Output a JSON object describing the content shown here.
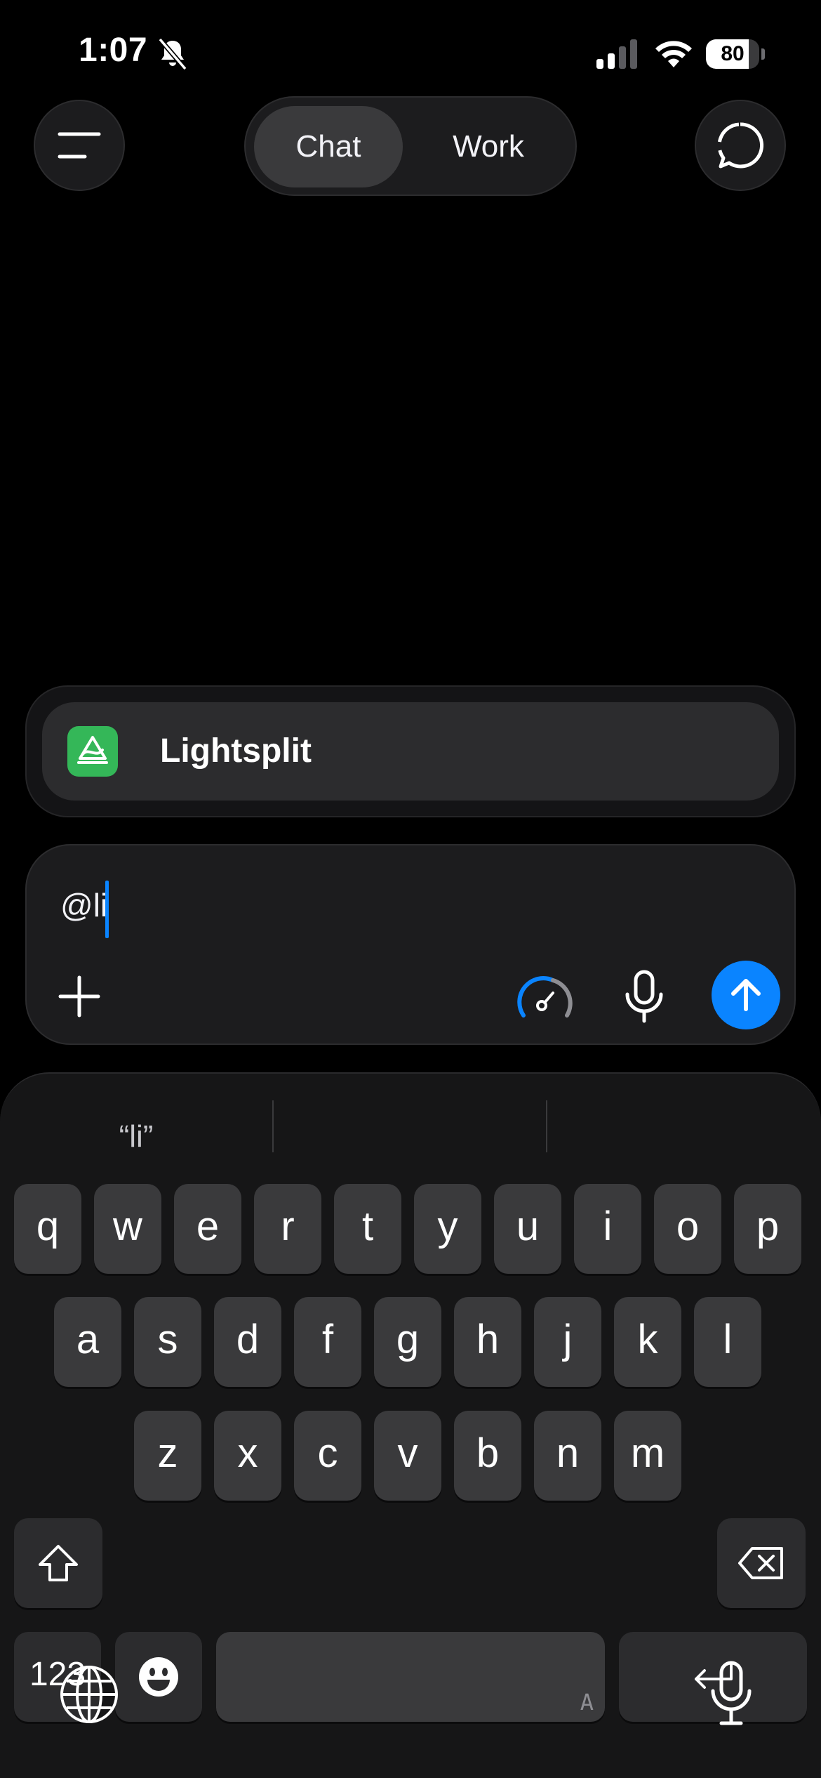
{
  "status_bar": {
    "time": "1:07",
    "battery": "80",
    "battery_level": 0.8
  },
  "header": {
    "tabs": [
      {
        "label": "Chat",
        "selected": true
      },
      {
        "label": "Work",
        "selected": false
      }
    ]
  },
  "suggestion": {
    "label": "Lightsplit",
    "icon": "lightsplit-app-icon"
  },
  "composer": {
    "text": "@li"
  },
  "keyboard": {
    "predictions": [
      "“li”",
      "",
      ""
    ],
    "row1": [
      "q",
      "w",
      "e",
      "r",
      "t",
      "y",
      "u",
      "i",
      "o",
      "p"
    ],
    "row2": [
      "a",
      "s",
      "d",
      "f",
      "g",
      "h",
      "j",
      "k",
      "l"
    ],
    "row3": [
      "z",
      "x",
      "c",
      "v",
      "b",
      "n",
      "m"
    ],
    "numbers_label": "123",
    "space_hint": "A"
  },
  "colors": {
    "accent": "#0a84ff",
    "app_icon_green": "#34b758",
    "background": "#000000"
  }
}
